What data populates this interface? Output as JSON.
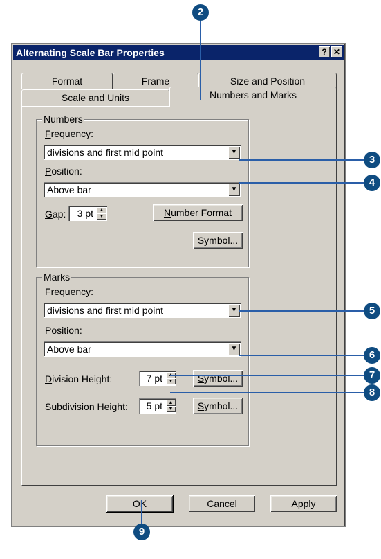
{
  "window": {
    "title": "Alternating Scale Bar Properties",
    "help_btn": "?",
    "close_btn": "✕"
  },
  "tabs": {
    "row_back": [
      "Format",
      "Frame",
      "Size and Position"
    ],
    "row_front": [
      "Scale and Units",
      "Numbers and Marks"
    ],
    "active": "Numbers and Marks"
  },
  "numbers": {
    "group_label": "Numbers",
    "frequency_label_u": "F",
    "frequency_label_rest": "requency:",
    "frequency_value": "divisions and first mid point",
    "position_label_u": "P",
    "position_label_rest": "osition:",
    "position_value": "Above bar",
    "gap_label_u": "G",
    "gap_label_rest": "ap:",
    "gap_value": "3 pt",
    "number_format_u": "N",
    "number_format_rest": "umber Format",
    "symbol_u": "S",
    "symbol_rest": "ymbol..."
  },
  "marks": {
    "group_label": "Marks",
    "frequency_label_u": "F",
    "frequency_label_rest": "requency:",
    "frequency_value": "divisions and first mid point",
    "position_label_u": "P",
    "position_label_rest": "osition:",
    "position_value": "Above bar",
    "division_label_u": "D",
    "division_label_rest": "ivision Height:",
    "division_value": "7 pt",
    "subdivision_label_u": "S",
    "subdivision_label_rest": "ubdivision Height:",
    "subdivision_value": "5 pt",
    "symbol_u": "S",
    "symbol_rest": "ymbol..."
  },
  "buttons": {
    "ok": "OK",
    "cancel": "Cancel",
    "apply_u": "A",
    "apply_rest": "pply"
  },
  "callouts": [
    "2",
    "3",
    "4",
    "5",
    "6",
    "7",
    "8",
    "9"
  ]
}
